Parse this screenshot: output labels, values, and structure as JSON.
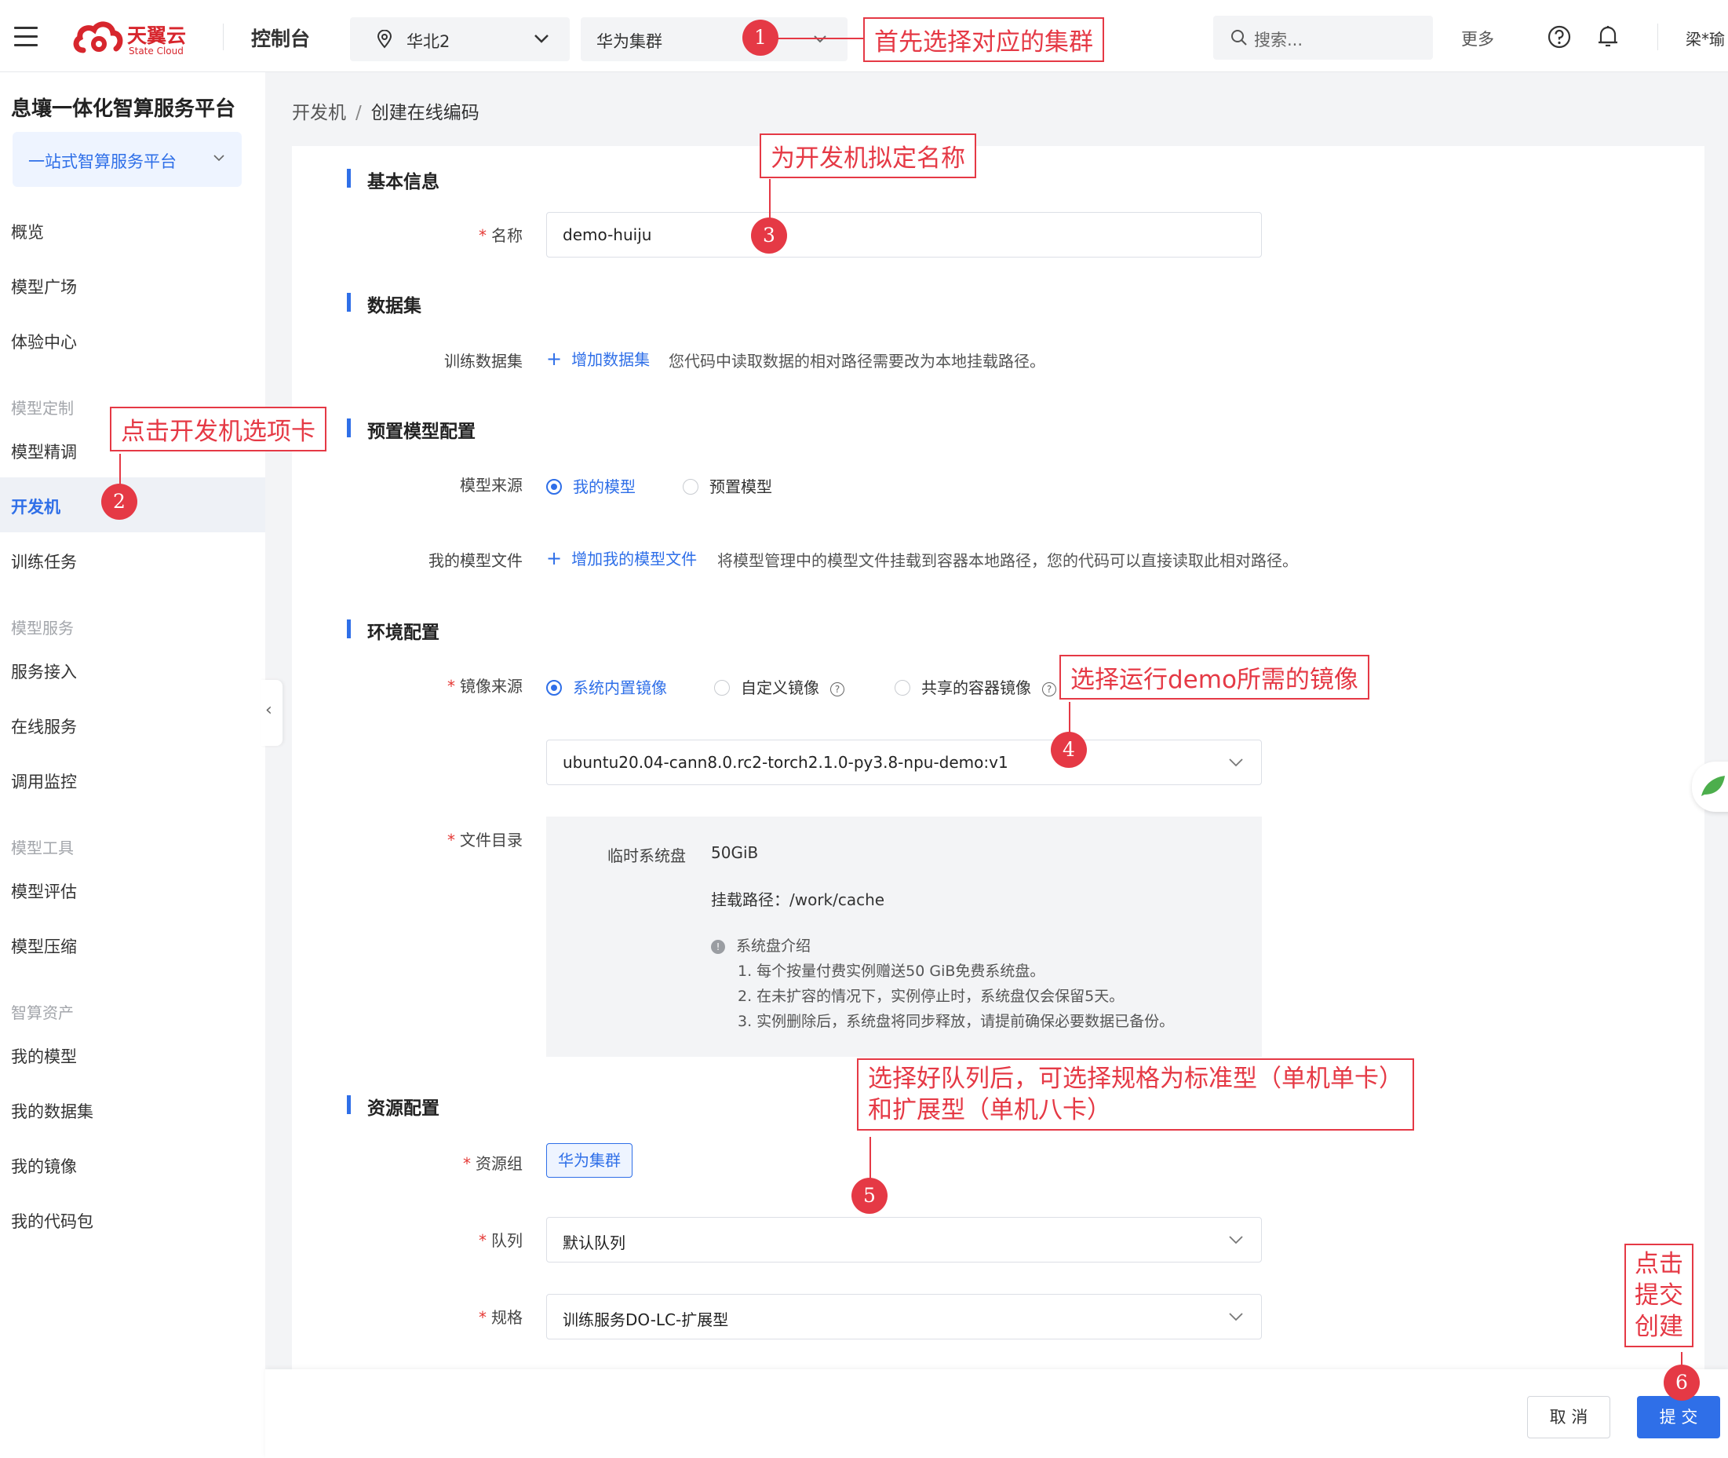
{
  "topbar": {
    "logo_text": "天翼云",
    "logo_sub": "State Cloud",
    "console": "控制台",
    "region": "华北2",
    "cluster": "华为集群",
    "search_placeholder": "搜索...",
    "more": "更多",
    "user": "梁*瑜"
  },
  "sidebar": {
    "platform_title": "息壤一体化智算服务平台",
    "platform_select": "一站式智算服务平台",
    "items": {
      "overview": "概览",
      "model_square": "模型广场",
      "experience": "体验中心",
      "group_custom": "模型定制",
      "finetune": "模型精调",
      "devmachine": "开发机",
      "training": "训练任务",
      "group_service": "模型服务",
      "access": "服务接入",
      "online": "在线服务",
      "monitor": "调用监控",
      "group_tools": "模型工具",
      "evaluate": "模型评估",
      "compress": "模型压缩",
      "group_assets": "智算资产",
      "my_models": "我的模型",
      "my_datasets": "我的数据集",
      "my_images": "我的镜像",
      "my_code": "我的代码包"
    }
  },
  "breadcrumb": {
    "parent": "开发机",
    "separator": "/",
    "current": "创建在线编码"
  },
  "form": {
    "basic": {
      "title": "基本信息",
      "name_label": "名称",
      "name_value": "demo-huiju"
    },
    "dataset": {
      "title": "数据集",
      "train_label": "训练数据集",
      "add_link": "增加数据集",
      "hint": "您代码中读取数据的相对路径需要改为本地挂载路径。"
    },
    "preset": {
      "title": "预置模型配置",
      "source_label": "模型来源",
      "opt_mine": "我的模型",
      "opt_preset": "预置模型",
      "file_label": "我的模型文件",
      "add_link": "增加我的模型文件",
      "hint": "将模型管理中的模型文件挂载到容器本地路径，您的代码可以直接读取此相对路径。"
    },
    "env": {
      "title": "环境配置",
      "image_label": "镜像来源",
      "opt_builtin": "系统内置镜像",
      "opt_custom": "自定义镜像",
      "opt_shared": "共享的容器镜像",
      "image_value": "ubuntu20.04-cann8.0.rc2-torch2.1.0-py3.8-npu-demo:v1",
      "dir_label": "文件目录",
      "disk_label": "临时系统盘",
      "disk_value": "50GiB",
      "mount": "挂载路径：/work/cache",
      "info_title": "系统盘介绍",
      "info_1": "1. 每个按量付费实例赠送50 GiB免费系统盘。",
      "info_2": "2. 在未扩容的情况下，实例停止时，系统盘仅会保留5天。",
      "info_3": "3. 实例删除后，系统盘将同步释放，请提前确保必要数据已备份。"
    },
    "resource": {
      "title": "资源配置",
      "group_label": "资源组",
      "group_value": "华为集群",
      "queue_label": "队列",
      "queue_value": "默认队列",
      "spec_label": "规格",
      "spec_value": "训练服务DO-LC-扩展型"
    }
  },
  "footer": {
    "cancel": "取 消",
    "submit": "提 交"
  },
  "annotations": {
    "a1": "首先选择对应的集群",
    "a2": "点击开发机选项卡",
    "a3": "为开发机拟定名称",
    "a4": "选择运行demo所需的镜像",
    "a5_line1": "选择好队列后，可选择规格为标准型（单机单卡）",
    "a5_line2": "和扩展型（单机八卡）",
    "a6_line1": "点击",
    "a6_line2": "提交",
    "a6_line3": "创建",
    "n1": "1",
    "n2": "2",
    "n3": "3",
    "n4": "4",
    "n5": "5",
    "n6": "6"
  },
  "colors": {
    "accent": "#2f6fe8",
    "annotation": "#e53945",
    "brand": "#d7262d"
  }
}
